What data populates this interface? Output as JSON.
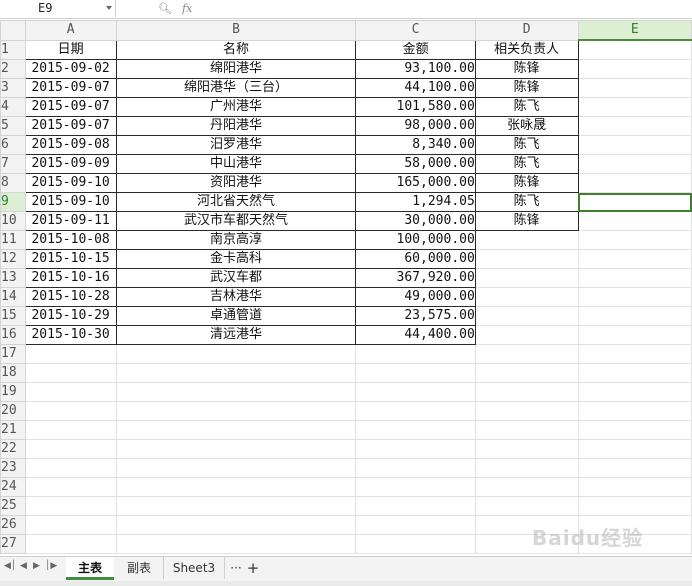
{
  "name_box": "E9",
  "fx_label": "fx",
  "columns": [
    "A",
    "B",
    "C",
    "D",
    "E"
  ],
  "header_row": {
    "a": "日期",
    "b": "名称",
    "c": "金额",
    "d": "相关负责人"
  },
  "rows": [
    {
      "row": "2",
      "a": "2015-09-02",
      "b": "绵阳港华",
      "c": "93,100.00",
      "d": "陈锋"
    },
    {
      "row": "3",
      "a": "2015-09-07",
      "b": "绵阳港华（三台）",
      "c": "44,100.00",
      "d": "陈锋"
    },
    {
      "row": "4",
      "a": "2015-09-07",
      "b": "广州港华",
      "c": "101,580.00",
      "d": "陈飞"
    },
    {
      "row": "5",
      "a": "2015-09-07",
      "b": "丹阳港华",
      "c": "98,000.00",
      "d": "张咏晟"
    },
    {
      "row": "6",
      "a": "2015-09-08",
      "b": "汨罗港华",
      "c": "8,340.00",
      "d": "陈飞"
    },
    {
      "row": "7",
      "a": "2015-09-09",
      "b": "中山港华",
      "c": "58,000.00",
      "d": "陈飞"
    },
    {
      "row": "8",
      "a": "2015-09-10",
      "b": "资阳港华",
      "c": "165,000.00",
      "d": "陈锋"
    },
    {
      "row": "9",
      "a": "2015-09-10",
      "b": "河北省天然气",
      "c": "1,294.05",
      "d": "陈飞"
    },
    {
      "row": "10",
      "a": "2015-09-11",
      "b": "武汉市车都天然气",
      "c": "30,000.00",
      "d": "陈锋"
    },
    {
      "row": "11",
      "a": "2015-10-08",
      "b": "南京高淳",
      "c": "100,000.00",
      "d": ""
    },
    {
      "row": "12",
      "a": "2015-10-15",
      "b": "金卡高科",
      "c": "60,000.00",
      "d": ""
    },
    {
      "row": "13",
      "a": "2015-10-16",
      "b": "武汉车都",
      "c": "367,920.00",
      "d": ""
    },
    {
      "row": "14",
      "a": "2015-10-28",
      "b": "吉林港华",
      "c": "49,000.00",
      "d": ""
    },
    {
      "row": "15",
      "a": "2015-10-29",
      "b": "卓通管道",
      "c": "23,575.00",
      "d": ""
    },
    {
      "row": "16",
      "a": "2015-10-30",
      "b": "清远港华",
      "c": "44,400.00",
      "d": ""
    }
  ],
  "empty_rows": [
    "17",
    "18",
    "19",
    "20",
    "21",
    "22",
    "23",
    "24",
    "25",
    "26",
    "27"
  ],
  "sheet_tabs": [
    {
      "label": "主表",
      "active": true
    },
    {
      "label": "副表",
      "active": false
    },
    {
      "label": "Sheet3",
      "active": false
    }
  ],
  "tab_more": "···",
  "tab_add": "+",
  "watermark": "Baidu经验",
  "colors": {
    "accent": "#3f7f2f",
    "selected_header": "#ddefd2"
  }
}
